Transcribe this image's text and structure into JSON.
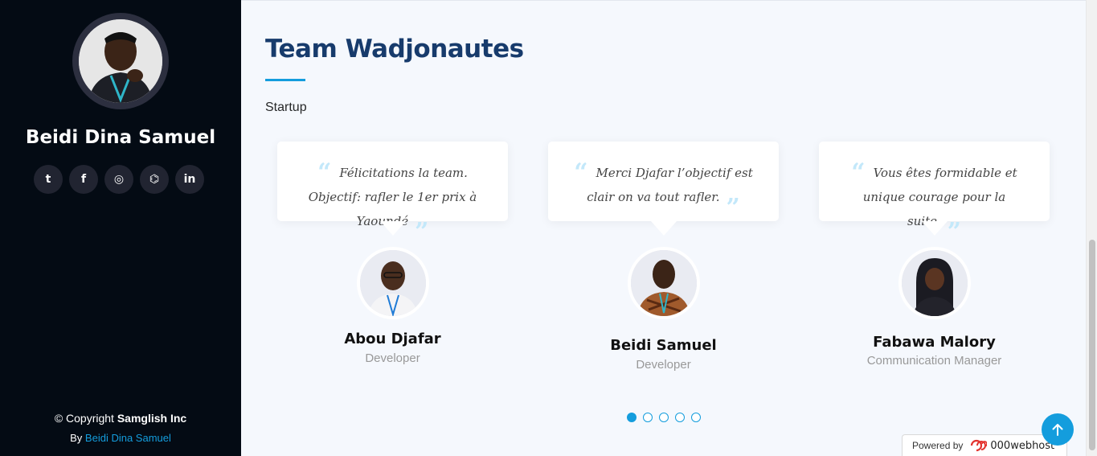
{
  "sidebar": {
    "name": "Beidi Dina Samuel",
    "socials": [
      {
        "icon": "twitter-icon",
        "glyph": "t"
      },
      {
        "icon": "facebook-icon",
        "glyph": "f"
      },
      {
        "icon": "instagram-icon",
        "glyph": "◎"
      },
      {
        "icon": "github-icon",
        "glyph": "⌬"
      },
      {
        "icon": "linkedin-icon",
        "glyph": "in"
      }
    ],
    "copyright_prefix": "© Copyright",
    "copyright_company": "Samglish Inc",
    "credits_prefix": "By",
    "credits_link": "Beidi Dina Samuel"
  },
  "section": {
    "title": "Team Wadjonautes",
    "subtitle": "Startup"
  },
  "testimonials": [
    {
      "quote": "Félicitations la team. Objectif: rafler le 1er prix à Yaoundé",
      "name": "Abou Djafar",
      "role": "Developer"
    },
    {
      "quote": "Merci Djafar l’objectif est clair on va tout rafler.",
      "name": "Beidi Samuel",
      "role": "Developer"
    },
    {
      "quote": "Vous êtes formidable et unique courage pour la suite.",
      "name": "Fabawa Malory",
      "role": "Communication Manager"
    }
  ],
  "pagination": {
    "count": 5,
    "active_index": 0
  },
  "footer": {
    "powered_label": "Powered by",
    "powered_brand": "000webhost"
  },
  "colors": {
    "accent": "#149ddd",
    "sidebar_bg": "#040b14",
    "title": "#173b6c"
  }
}
